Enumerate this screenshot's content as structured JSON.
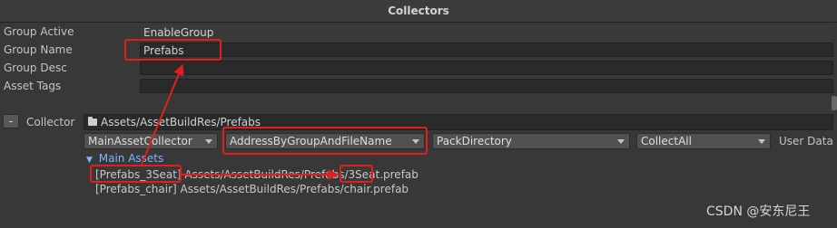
{
  "header": {
    "title": "Collectors"
  },
  "group": {
    "active_label": "Group Active",
    "active_value": "EnableGroup",
    "name_label": "Group Name",
    "name_value": "Prefabs",
    "desc_label": "Group Desc",
    "desc_value": "",
    "tags_label": "Asset Tags",
    "tags_value": ""
  },
  "collector": {
    "remove_label": "-",
    "label": "Collector",
    "path": "Assets/AssetBuildRes/Prefabs",
    "collector_type": "MainAssetCollector",
    "address_rule": "AddressByGroupAndFileName",
    "pack_rule": "PackDirectory",
    "filter_rule": "CollectAll",
    "user_data_label": "User Data",
    "main_assets_label": "Main Assets",
    "assets": [
      {
        "address": "[Prefabs_3Seat]",
        "path_prefix": "Assets/AssetBuildRes/Prefabs/",
        "file_name": "3Seat",
        "ext": ".prefab"
      },
      {
        "address": "[Prefabs_chair]",
        "path_prefix": "Assets/AssetBuildRes/Prefabs/",
        "file_name": "chair",
        "ext": ".prefab"
      }
    ]
  },
  "watermark": "CSDN @安东尼王",
  "colors": {
    "annotation": "#e02020",
    "foldout": "#7cb4ff",
    "background": "#383838"
  },
  "icons": {
    "folder": "folder-icon",
    "foldout": "foldout-arrow-icon",
    "dropdown": "chevron-down-icon"
  }
}
